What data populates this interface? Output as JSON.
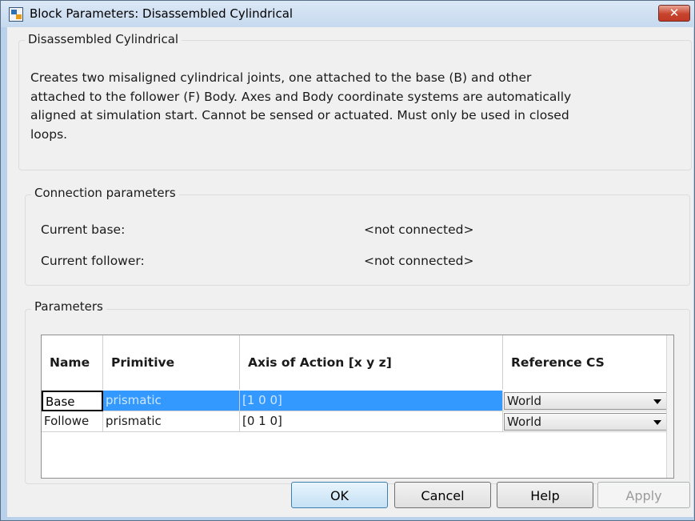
{
  "window": {
    "title": "Block Parameters: Disassembled Cylindrical",
    "close_symbol": "✕"
  },
  "description": {
    "group_title": "Disassembled Cylindrical",
    "text": "Creates two misaligned cylindrical joints, one attached to the base (B) and other\nattached to the follower (F) Body. Axes and Body coordinate systems are automatically\naligned at simulation start. Cannot be sensed or actuated. Must only be used in closed\nloops."
  },
  "connection": {
    "group_title": "Connection parameters",
    "base_label": "Current base:",
    "base_value": "<not connected>",
    "follower_label": "Current follower:",
    "follower_value": "<not connected>"
  },
  "parameters": {
    "group_title": "Parameters",
    "columns": [
      "Name",
      "Primitive",
      "Axis of Action [x y z]",
      "Reference CS"
    ],
    "rows": [
      {
        "name": "Base",
        "primitive": "prismatic",
        "axis": "[1 0 0]",
        "reference": "World"
      },
      {
        "name": "Followe",
        "primitive": "prismatic",
        "axis": "[0 1 0]",
        "reference": "World"
      }
    ]
  },
  "buttons": {
    "ok": "OK",
    "cancel": "Cancel",
    "help": "Help",
    "apply": "Apply"
  },
  "colors": {
    "selection": "#3399ff",
    "close_button": "#c7432e"
  }
}
